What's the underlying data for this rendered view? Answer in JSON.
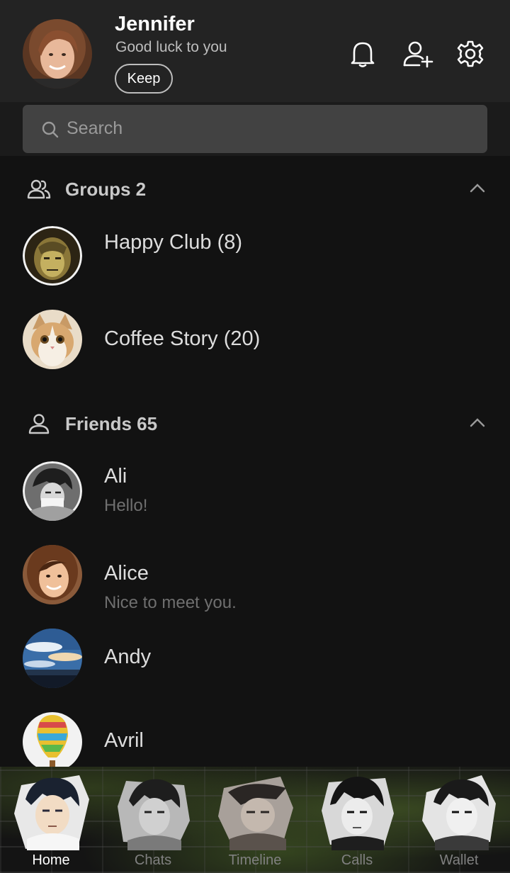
{
  "profile": {
    "name": "Jennifer",
    "status": "Good luck to you",
    "keep_label": "Keep"
  },
  "header_icons": [
    "bell-icon",
    "add-friend-icon",
    "gear-icon"
  ],
  "search": {
    "placeholder": "Search"
  },
  "groups": {
    "title": "Groups 2",
    "items": [
      {
        "name": "Happy Club (8)"
      },
      {
        "name": "Coffee Story (20)"
      }
    ]
  },
  "friends": {
    "title": "Friends 65",
    "items": [
      {
        "name": "Ali",
        "message": "Hello!"
      },
      {
        "name": "Alice",
        "message": "Nice to meet you."
      },
      {
        "name": "Andy",
        "message": ""
      },
      {
        "name": "Avril",
        "message": ""
      }
    ]
  },
  "nav": {
    "items": [
      {
        "label": "Home",
        "active": true
      },
      {
        "label": "Chats",
        "active": false
      },
      {
        "label": "Timeline",
        "active": false
      },
      {
        "label": "Calls",
        "active": false
      },
      {
        "label": "Wallet",
        "active": false
      }
    ]
  },
  "colors": {
    "background": "#121212",
    "header": "#232323",
    "search_box": "#424242",
    "text_primary": "#dddddd",
    "text_muted": "#6f6f6f"
  }
}
